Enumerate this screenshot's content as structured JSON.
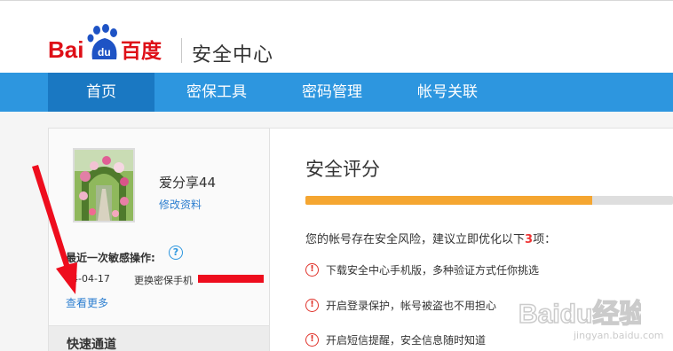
{
  "brand": {
    "logo_bai": "Bai",
    "logo_du": "du",
    "logo_cn": "百度",
    "site_title": "安全中心",
    "red": "#de0f17",
    "blue": "#2d96df"
  },
  "nav": {
    "items": [
      {
        "label": "首页",
        "active": true
      },
      {
        "label": "密保工具",
        "active": false
      },
      {
        "label": "密码管理",
        "active": false
      },
      {
        "label": "帐号关联",
        "active": false
      }
    ]
  },
  "profile": {
    "username": "爱分享44",
    "edit_label": "修改资料"
  },
  "sensitive": {
    "label": "最近一次敏感操作:",
    "help": "?",
    "date": "14-04-17",
    "action": "更换密保手机",
    "more_label": "查看更多"
  },
  "quick": {
    "title": "快速通道"
  },
  "main": {
    "title": "安全评分",
    "score_fraction": 0.78,
    "risk_prefix": "您的帐号存在安全风险，建议立即优化以下",
    "risk_count": "3",
    "risk_suffix": "项：",
    "items": [
      "下载安全中心手机版，多种验证方式任你挑选",
      "开启登录保护，帐号被盗也不用担心",
      "开启短信提醒，安全信息随时知道"
    ]
  },
  "watermark": {
    "text": "Baidu经验",
    "sub": "jingyan.baidu.com"
  }
}
